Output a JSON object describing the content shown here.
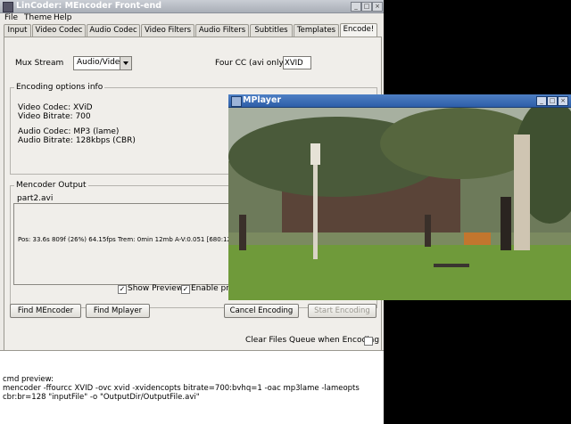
{
  "window": {
    "title": "LinCoder: MEncoder Front-end"
  },
  "menu": [
    "File",
    "Theme",
    "Help"
  ],
  "tabs": [
    "Input",
    "Video Codec",
    "Audio Codec",
    "Video Filters",
    "Audio Filters",
    "Subtitles",
    "Templates",
    "Encode!"
  ],
  "encode": {
    "mux_label": "Mux Stream",
    "mux_value": "Audio/Video",
    "fourcc_label": "Four CC (avi only):",
    "fourcc_value": "XVID",
    "info_title": "Encoding options info",
    "video_codec": "Video Codec: XViD",
    "video_bitrate": "Video Bitrate: 700",
    "audio_codec": "Audio Codec: MP3 (lame)",
    "audio_bitrate": "Audio Bitrate: 128kbps (CBR)",
    "output_title": "Mencoder Output",
    "output_file": "part2.avi",
    "output_status": "Pos:  33.6s    809f (26%) 64.15fps Trem:   0min  12mb  A-V:0.051 [680:128]",
    "show_preview": "Show Preview",
    "enable_preview": "Enable pre",
    "find_mencoder": "Find MEncoder",
    "find_mplayer": "Find Mplayer",
    "cancel_encoding": "Cancel Encoding",
    "start_encoding": "Start Encoding",
    "clear_queue": "Clear Files Queue when Encoding"
  },
  "cmd": {
    "label": "cmd preview:",
    "line1": "mencoder -ffourcc XVID -ovc xvid -xvidencopts bitrate=700:bvhq=1 -oac mp3lame -lameopts",
    "line2": "cbr:br=128 \"inputFile\" -o \"OutputDir/OutputFile.avi\""
  },
  "mplayer": {
    "title": "MPlayer"
  }
}
